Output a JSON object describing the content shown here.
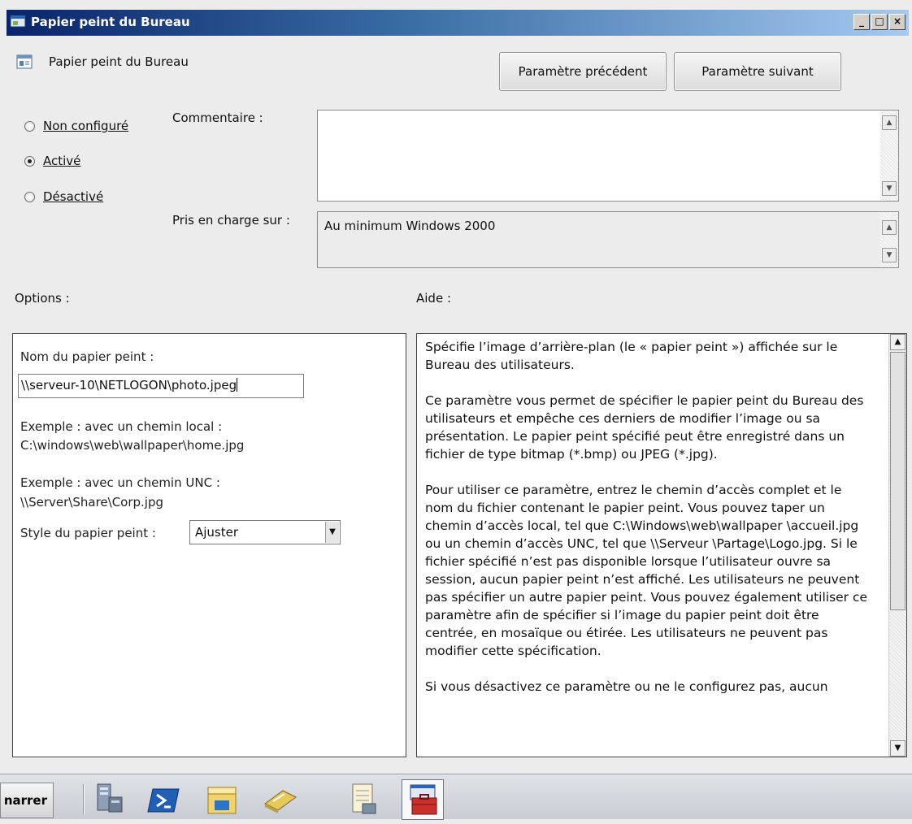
{
  "window": {
    "title": "Papier peint du Bureau",
    "controls": [
      "minimize",
      "maximize",
      "close"
    ]
  },
  "header": {
    "policy_name": "Papier peint du Bureau",
    "prev_button": "Paramètre précédent",
    "next_button": "Paramètre suivant"
  },
  "state": {
    "not_configured": "Non configuré",
    "enabled": "Activé",
    "disabled": "Désactivé",
    "selected": "Activé"
  },
  "comment": {
    "label": "Commentaire :",
    "value": ""
  },
  "supported": {
    "label": "Pris en charge sur :",
    "value": "Au minimum Windows 2000"
  },
  "sections": {
    "options": "Options :",
    "help": "Aide :"
  },
  "options": {
    "wallpaper_name_label": "Nom du papier peint :",
    "wallpaper_path": "\\\\serveur-10\\NETLOGON\\photo.jpeg",
    "example_local_label": "Exemple : avec un chemin local :",
    "example_local_path": "C:\\windows\\web\\wallpaper\\home.jpg",
    "example_unc_label": "Exemple : avec un chemin UNC :",
    "example_unc_path": "\\\\Server\\Share\\Corp.jpg",
    "style_label": "Style du papier peint :",
    "style_value": "Ajuster"
  },
  "help": {
    "p1": "Spécifie l’image d’arrière-plan (le « papier peint ») affichée sur le Bureau des utilisateurs.",
    "p2": "Ce paramètre vous permet de spécifier le papier peint du Bureau des utilisateurs et empêche ces derniers de modifier l’image ou sa présentation. Le papier peint spécifié peut être enregistré dans un fichier de type bitmap (*.bmp) ou JPEG (*.jpg).",
    "p3": "Pour utiliser ce paramètre, entrez le chemin d’accès complet et le nom du fichier contenant le papier peint. Vous pouvez taper un chemin d’accès local, tel que C:\\Windows\\web\\wallpaper \\accueil.jpg ou un chemin d’accès UNC, tel que \\\\Serveur \\Partage\\Logo.jpg. Si le fichier spécifié n’est pas disponible lorsque l’utilisateur ouvre sa session, aucun papier peint n’est affiché. Les utilisateurs ne peuvent pas spécifier un autre papier peint. Vous pouvez également utiliser ce paramètre afin de spécifier si l’image du papier peint doit être centrée, en mosaïque ou étirée. Les utilisateurs ne peuvent pas modifier cette spécification.",
    "p4": "Si vous désactivez ce paramètre ou ne le configurez pas, aucun"
  },
  "taskbar": {
    "start_label": "narrer",
    "apps": [
      "server-manager-icon",
      "powershell-icon",
      "explorer-icon",
      "scanner-icon",
      "notepad-icon",
      "toolbox-icon"
    ],
    "active_app": "toolbox-icon"
  }
}
